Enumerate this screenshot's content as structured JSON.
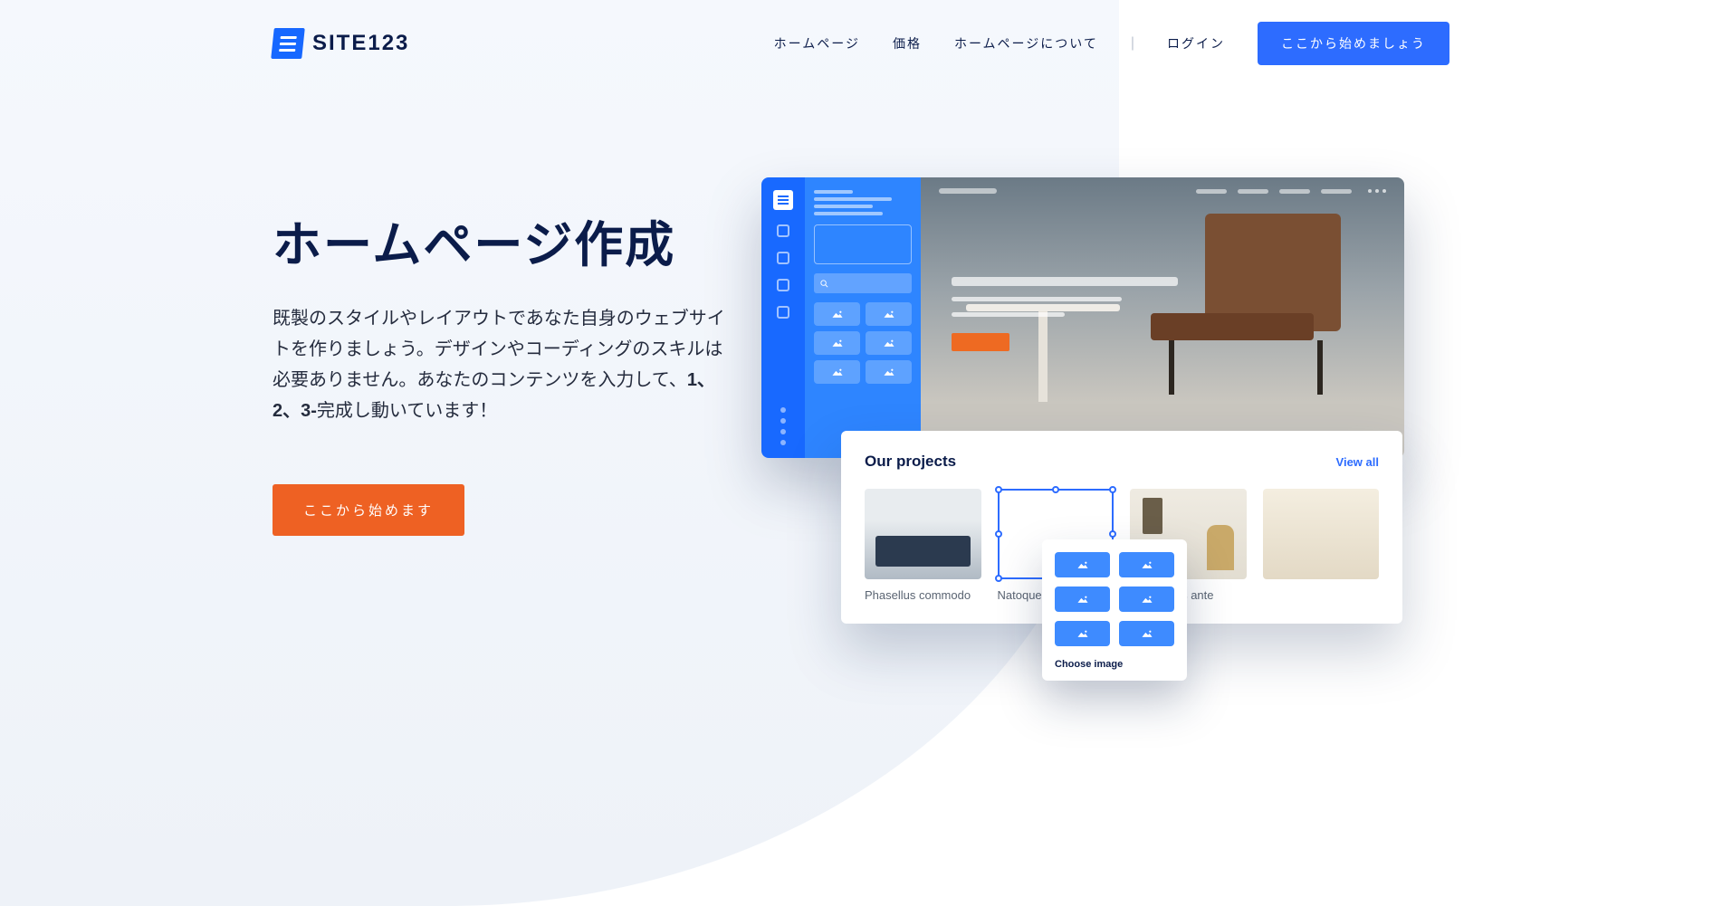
{
  "brand": {
    "name": "SITE123"
  },
  "nav": {
    "home": "ホームページ",
    "pricing": "価格",
    "about": "ホームページについて",
    "login": "ログイン",
    "cta": "ここから始めましょう"
  },
  "hero": {
    "title": "ホームページ作成",
    "lead_pre": "既製のスタイルやレイアウトであなた自身のウェブサイトを作りましょう。デザインやコーディングのスキルは必要ありません。あなたのコンテンツを入力して、",
    "lead_bold": "1、2、3-",
    "lead_post": "完成し動いています！",
    "cta": "ここから始めます"
  },
  "projects": {
    "title": "Our projects",
    "view_all": "View all",
    "items": [
      {
        "label": "Phasellus commodo"
      },
      {
        "label": "Natoque"
      },
      {
        "label": "culis luctus ante"
      },
      {
        "label": ""
      }
    ]
  },
  "chooser": {
    "label": "Choose image"
  }
}
